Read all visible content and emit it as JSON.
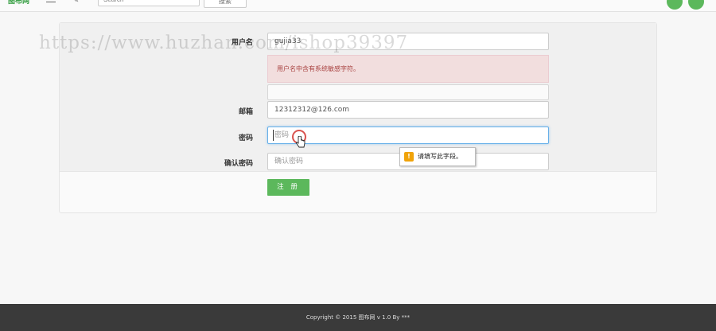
{
  "header": {
    "brand": "图布网",
    "search_placeholder": "Search",
    "search_button": "搜索"
  },
  "form": {
    "username_label": "用户名",
    "username_value": "gujia33",
    "error_message": "用户名中含有系统敏感字符。",
    "email_label": "邮箱",
    "email_value": "12312312@126.com",
    "password_label": "密码",
    "password_placeholder": "密码",
    "confirm_label": "确认密码",
    "confirm_placeholder": "确认密码",
    "register_button": "注 册"
  },
  "tooltip": {
    "icon_text": "!",
    "message": "请填写此字段。"
  },
  "watermark": "https://www.huzhan.com/ishop39397",
  "footer": {
    "copyright": "Copyright © 2015 图布网 v 1.0 By ***"
  },
  "colors": {
    "accent": "#5cb85c",
    "error_bg": "#f2dede",
    "error_text": "#a94442",
    "footer_bg": "#3a3a3a"
  }
}
